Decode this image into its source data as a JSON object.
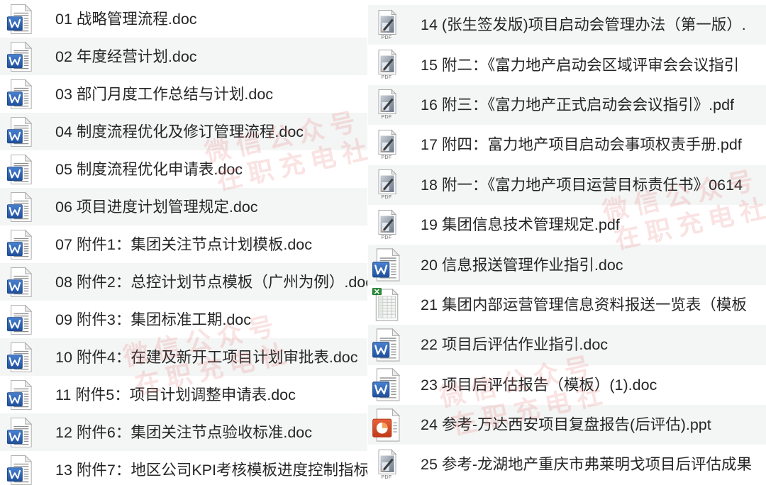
{
  "left_column": {
    "files": [
      {
        "name": "01 战略管理流程.doc",
        "icon": "word-doc-icon"
      },
      {
        "name": "02 年度经营计划.doc",
        "icon": "word-doc-icon"
      },
      {
        "name": "03 部门月度工作总结与计划.doc",
        "icon": "word-doc-icon"
      },
      {
        "name": "04 制度流程优化及修订管理流程.doc",
        "icon": "word-doc-icon"
      },
      {
        "name": "05 制度流程优化申请表.doc",
        "icon": "word-doc-icon"
      },
      {
        "name": "06 项目进度计划管理规定.doc",
        "icon": "word-doc-icon"
      },
      {
        "name": "07 附件1：集团关注节点计划模板.doc",
        "icon": "word-doc-icon"
      },
      {
        "name": "08 附件2：总控计划节点模板（广州为例）.doc",
        "icon": "word-doc-icon"
      },
      {
        "name": "09 附件3：集团标准工期.doc",
        "icon": "word-doc-icon"
      },
      {
        "name": "10 附件4：在建及新开工项目计划审批表.doc",
        "icon": "word-doc-icon"
      },
      {
        "name": "11 附件5：项目计划调整申请表.doc",
        "icon": "word-doc-icon"
      },
      {
        "name": "12 附件6：集团关注节点验收标准.doc",
        "icon": "word-doc-icon"
      },
      {
        "name": "13 附件7：地区公司KPI考核模板进度控制指标",
        "icon": "word-doc-icon"
      }
    ]
  },
  "right_column": {
    "files": [
      {
        "name": "14 (张生签发版)项目启动会管理办法（第一版）.",
        "icon": "pdf-icon"
      },
      {
        "name": "15 附二：《富力地产启动会区域评审会会议指引",
        "icon": "pdf-icon"
      },
      {
        "name": "16 附三：《富力地产正式启动会会议指引》.pdf",
        "icon": "pdf-icon"
      },
      {
        "name": "17 附四：富力地产项目启动会事项权责手册.pdf",
        "icon": "pdf-icon"
      },
      {
        "name": "18 附一：《富力地产项目运营目标责任书》0614",
        "icon": "pdf-icon"
      },
      {
        "name": "19 集团信息技术管理规定.pdf",
        "icon": "pdf-icon"
      },
      {
        "name": "20 信息报送管理作业指引.doc",
        "icon": "word-doc-icon"
      },
      {
        "name": "21 集团内部运营管理信息资料报送一览表（模板",
        "icon": "excel-icon"
      },
      {
        "name": "22 项目后评估作业指引.doc",
        "icon": "word-doc-icon"
      },
      {
        "name": "23 项目后评估报告（模板）(1).doc",
        "icon": "word-doc-icon"
      },
      {
        "name": "24 参考-万达西安项目复盘报告(后评估).ppt",
        "icon": "powerpoint-icon"
      },
      {
        "name": "25 参考-龙湖地产重庆市弗莱明戈项目后评估成果",
        "icon": "pdf-icon"
      }
    ]
  },
  "icons": {
    "pdf_label": "PDF"
  },
  "watermarks": [
    {
      "line1": "微信公众号",
      "line2": "在职充电社"
    },
    {
      "line1": "微信公众号",
      "line2": "在职充电社"
    },
    {
      "line1": "微信公众号",
      "line2": "在职充电社"
    },
    {
      "line1": "微信公众号",
      "line2": "在职充电社"
    }
  ],
  "colors": {
    "row_alternate": "#f4f5f5",
    "text": "#262626",
    "watermark": "#e25656",
    "word_blue": "#2e63b1",
    "excel_green": "#2e8b3a",
    "powerpoint_red": "#d24625"
  }
}
